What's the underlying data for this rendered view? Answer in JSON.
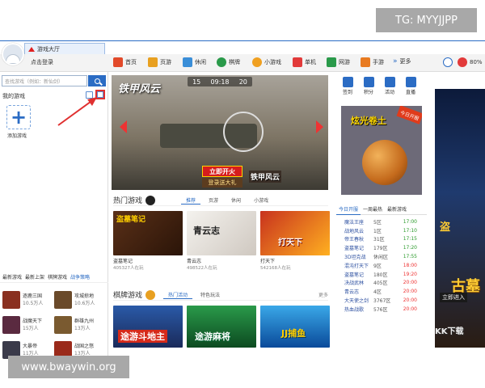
{
  "watermark_top": "TG: MYYJJPP",
  "watermark_bottom": "www.bwaywin.org",
  "watermark_corner": "KK下载",
  "app": {
    "title": "游戏大厅"
  },
  "header": {
    "login": "点击登录",
    "nav": [
      "首页",
      "页游",
      "休闲",
      "棋牌",
      "小游戏",
      "单机",
      "网游",
      "手游",
      "更多"
    ],
    "badge_count": "80%"
  },
  "sidebar": {
    "search_placeholder": "查找游戏（例如：新仙剑）",
    "my_games": "我的游戏",
    "add_game": "添加游戏",
    "tabs": [
      "最新游戏",
      "最新上架",
      "棋牌游戏",
      "战争策略"
    ],
    "games": [
      {
        "name": "逐鹿三国",
        "players": "10.5万人"
      },
      {
        "name": "攻城掠地",
        "players": "10.6万人"
      },
      {
        "name": "战魔天下",
        "players": "15万人"
      },
      {
        "name": "群雄九州",
        "players": "13万人"
      },
      {
        "name": "大暴帝",
        "players": "11万人"
      },
      {
        "name": "战国之怒",
        "players": "13万人"
      }
    ]
  },
  "banner": {
    "logo": "铁甲风云",
    "hud_left": "15",
    "hud_time": "09:18",
    "hud_right": "20",
    "cta": "立即开火",
    "cta_sub": "登录送大礼",
    "logo2": "铁甲风云"
  },
  "hot": {
    "title": "热门游戏",
    "tabs": [
      "推荐",
      "页游",
      "休闲",
      "小游戏"
    ],
    "tiles": [
      {
        "name": "盗墓笔记",
        "players": "405327人在玩",
        "caption": "盗墓笔记"
      },
      {
        "name": "青云志",
        "players": "498522人在玩",
        "caption": "青云志"
      },
      {
        "name": "打天下",
        "players": "542168人在玩",
        "caption": "打天下"
      }
    ]
  },
  "chess": {
    "title": "棋牌游戏",
    "tabs": [
      "热门活动",
      "特色玩法"
    ],
    "more": "更多",
    "tiles": [
      {
        "caption": "途游斗地主"
      },
      {
        "caption": "途游麻将"
      },
      {
        "caption": "JJ捕鱼"
      }
    ]
  },
  "right": {
    "tools": [
      "签到",
      "积分",
      "活动",
      "直播"
    ],
    "promo_title": "炫光卷土",
    "promo_badge": "今日开服",
    "server_tabs": [
      "今日开服",
      "一周最热",
      "最新游戏"
    ],
    "servers": [
      {
        "name": "魔法王座",
        "zone": "5区",
        "time": "17:00",
        "color": "green"
      },
      {
        "name": "战地风云",
        "zone": "1区",
        "time": "17:10",
        "color": "green"
      },
      {
        "name": "帝王春秋",
        "zone": "31区",
        "time": "17:15",
        "color": "green"
      },
      {
        "name": "盗墓笔记",
        "zone": "179区",
        "time": "17:20",
        "color": "green"
      },
      {
        "name": "3D坦克战",
        "zone": "休闲区",
        "time": "17:55",
        "color": "green"
      },
      {
        "name": "混沌打天下",
        "zone": "9区",
        "time": "18:00",
        "color": "red"
      },
      {
        "name": "盗墓笔记",
        "zone": "180区",
        "time": "19:20",
        "color": "red"
      },
      {
        "name": "决战武林",
        "zone": "405区",
        "time": "20:00",
        "color": "red"
      },
      {
        "name": "青云志",
        "zone": "4区",
        "time": "20:00",
        "color": "red"
      },
      {
        "name": "大天使之剑",
        "zone": "3767区",
        "time": "20:00",
        "color": "red"
      },
      {
        "name": "热血战歌",
        "zone": "576区",
        "time": "20:00",
        "color": "red"
      }
    ]
  },
  "ad_right": {
    "title": "古墓",
    "sub": "盗",
    "cta": "立即进入"
  }
}
